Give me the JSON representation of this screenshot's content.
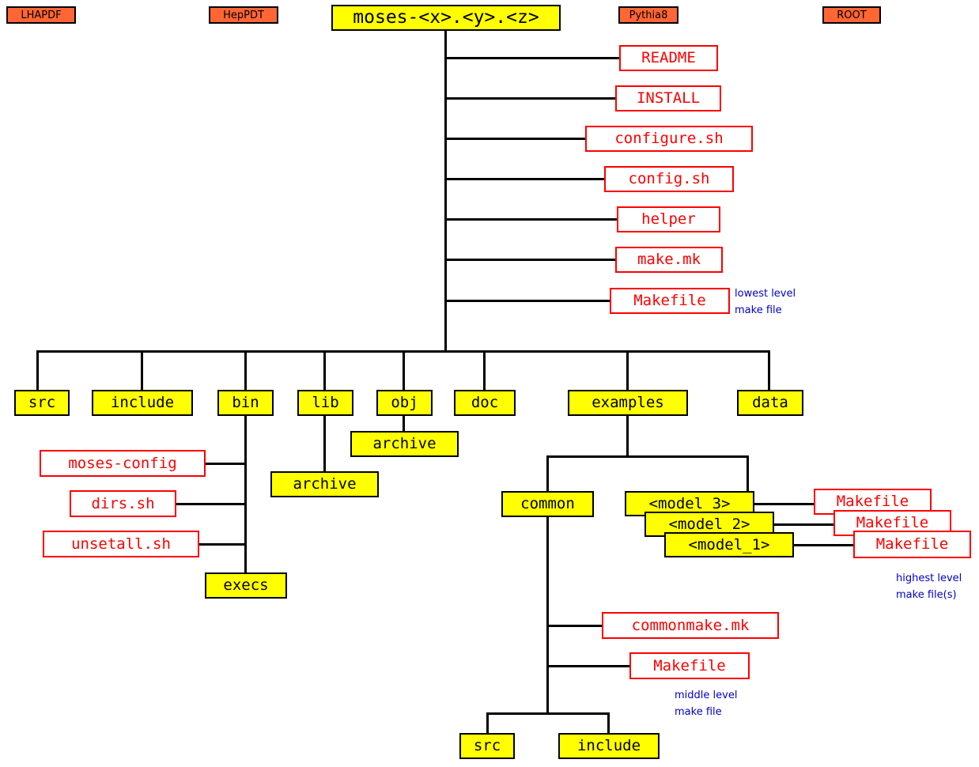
{
  "diagram": {
    "title": "moses source tree layout",
    "colors": {
      "directory_fill": "#ffff00",
      "directory_border": "#000000",
      "file_fill": "#ffffff",
      "file_border": "#ff0000",
      "file_text": "#ff0000",
      "external_fill": "#ff6633",
      "annotation_text": "#0000cc",
      "connector": "#000000",
      "background": "#ffffff"
    }
  },
  "external_packages": [
    {
      "label": "LHAPDF"
    },
    {
      "label": "HepPDT"
    },
    {
      "label": "Pythia8"
    },
    {
      "label": "ROOT"
    }
  ],
  "root": {
    "label": "moses-<x>.<y>.<z>"
  },
  "root_files": [
    {
      "label": "README"
    },
    {
      "label": "INSTALL"
    },
    {
      "label": "configure.sh"
    },
    {
      "label": "config.sh"
    },
    {
      "label": "helper"
    },
    {
      "label": "make.mk"
    },
    {
      "label": "Makefile"
    }
  ],
  "root_dirs": [
    {
      "label": "src"
    },
    {
      "label": "include"
    },
    {
      "label": "bin"
    },
    {
      "label": "lib"
    },
    {
      "label": "obj"
    },
    {
      "label": "doc"
    },
    {
      "label": "examples"
    },
    {
      "label": "data"
    }
  ],
  "bin_children": [
    {
      "label": "moses-config",
      "kind": "file"
    },
    {
      "label": "dirs.sh",
      "kind": "file"
    },
    {
      "label": "unsetall.sh",
      "kind": "file"
    },
    {
      "label": "execs",
      "kind": "dir"
    }
  ],
  "lib_children": [
    {
      "label": "archive",
      "kind": "dir"
    }
  ],
  "obj_children": [
    {
      "label": "archive",
      "kind": "dir"
    }
  ],
  "examples_children": [
    {
      "label": "common",
      "kind": "dir"
    },
    {
      "label": "<model_3>",
      "kind": "dir"
    },
    {
      "label": "<model_2>",
      "kind": "dir"
    },
    {
      "label": "<model_1>",
      "kind": "dir"
    }
  ],
  "model_makefiles": [
    {
      "label": "Makefile"
    },
    {
      "label": "Makefile"
    },
    {
      "label": "Makefile"
    }
  ],
  "common_children": [
    {
      "label": "commonmake.mk",
      "kind": "file"
    },
    {
      "label": "Makefile",
      "kind": "file"
    },
    {
      "label": "src",
      "kind": "dir"
    },
    {
      "label": "include",
      "kind": "dir"
    }
  ],
  "annotations": [
    {
      "line1": "lowest level",
      "line2": "make file"
    },
    {
      "line1": "highest level",
      "line2": "make file(s)"
    },
    {
      "line1": "middle level",
      "line2": "make file"
    }
  ]
}
